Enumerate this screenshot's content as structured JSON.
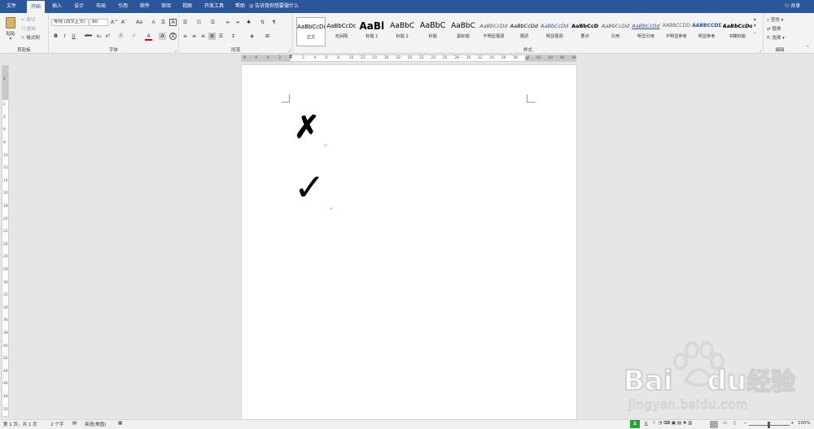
{
  "tabs": [
    "文件",
    "开始",
    "插入",
    "设计",
    "布局",
    "引用",
    "邮件",
    "审阅",
    "视图",
    "开发工具",
    "帮助"
  ],
  "tell_me": "告诉我你想要做什么",
  "share": "共享",
  "clipboard": {
    "paste": "粘贴",
    "cut": "剪切",
    "copy": "复制",
    "format_painter": "格式刷",
    "label": "剪贴板"
  },
  "font": {
    "name": "等线 (西文正文)",
    "size": "90",
    "label": "字体",
    "bold": "B",
    "italic": "I",
    "underline": "U",
    "strike": "abc",
    "sub": "x₂",
    "sup": "x²",
    "grow": "A^",
    "shrink": "Aˇ",
    "case": "Aa",
    "clear": "A",
    "wen": "文",
    "A_box": "A",
    "color_a": "A"
  },
  "paragraph": {
    "label": "段落"
  },
  "styles": {
    "label": "样式",
    "items": [
      {
        "preview": "AaBbCcDd",
        "name": "正文"
      },
      {
        "preview": "AaBbCcDd",
        "name": "无间隔"
      },
      {
        "preview": "AaBl",
        "name": "标题 1"
      },
      {
        "preview": "AaBbC",
        "name": "标题 2"
      },
      {
        "preview": "AaBbC",
        "name": "标题"
      },
      {
        "preview": "AaBbC",
        "name": "副标题"
      },
      {
        "preview": "AaBbCcDd",
        "name": "不明显强调"
      },
      {
        "preview": "AaBbCcDd",
        "name": "强调"
      },
      {
        "preview": "AaBbCcDd",
        "name": "明显强调"
      },
      {
        "preview": "AaBbCcD",
        "name": "要点"
      },
      {
        "preview": "AaBbCcDd",
        "name": "引用"
      },
      {
        "preview": "AaBbCcDd",
        "name": "明显引用"
      },
      {
        "preview": "AABBCCDD",
        "name": "不明显参考"
      },
      {
        "preview": "AABBCCDD",
        "name": "明显参考"
      },
      {
        "preview": "AaBbCcDd",
        "name": "书籍标题"
      }
    ]
  },
  "editing": {
    "find": "查找",
    "replace": "替换",
    "select": "选择",
    "label": "编辑"
  },
  "hruler_ticks": [
    "8",
    "6",
    "4",
    "2",
    "",
    "2",
    "4",
    "6",
    "8",
    "10",
    "12",
    "14",
    "16",
    "18",
    "20",
    "22",
    "24",
    "26",
    "28",
    "30",
    "32",
    "34",
    "36",
    "38",
    "40",
    "42",
    "44",
    "46",
    "48"
  ],
  "vruler_ticks": [
    "2",
    "",
    "2",
    "4",
    "6",
    "8",
    "10",
    "12",
    "14",
    "16",
    "18",
    "20",
    "22",
    "24",
    "26",
    "28",
    "30",
    "32",
    "34",
    "36",
    "38",
    "40",
    "42",
    "44",
    "46",
    "48",
    "50"
  ],
  "document": {
    "cross": "✗",
    "check": "✓",
    "para_mark": "↵"
  },
  "status": {
    "page": "第 1 页，共 1 页",
    "words": "2 个字",
    "lang": "英语(美国)",
    "zoom": "100%",
    "ime": "五"
  },
  "watermark": {
    "brand": "Bai",
    "brand2": "du",
    "cn": "经验",
    "url": "jingyan.baidu.com"
  }
}
